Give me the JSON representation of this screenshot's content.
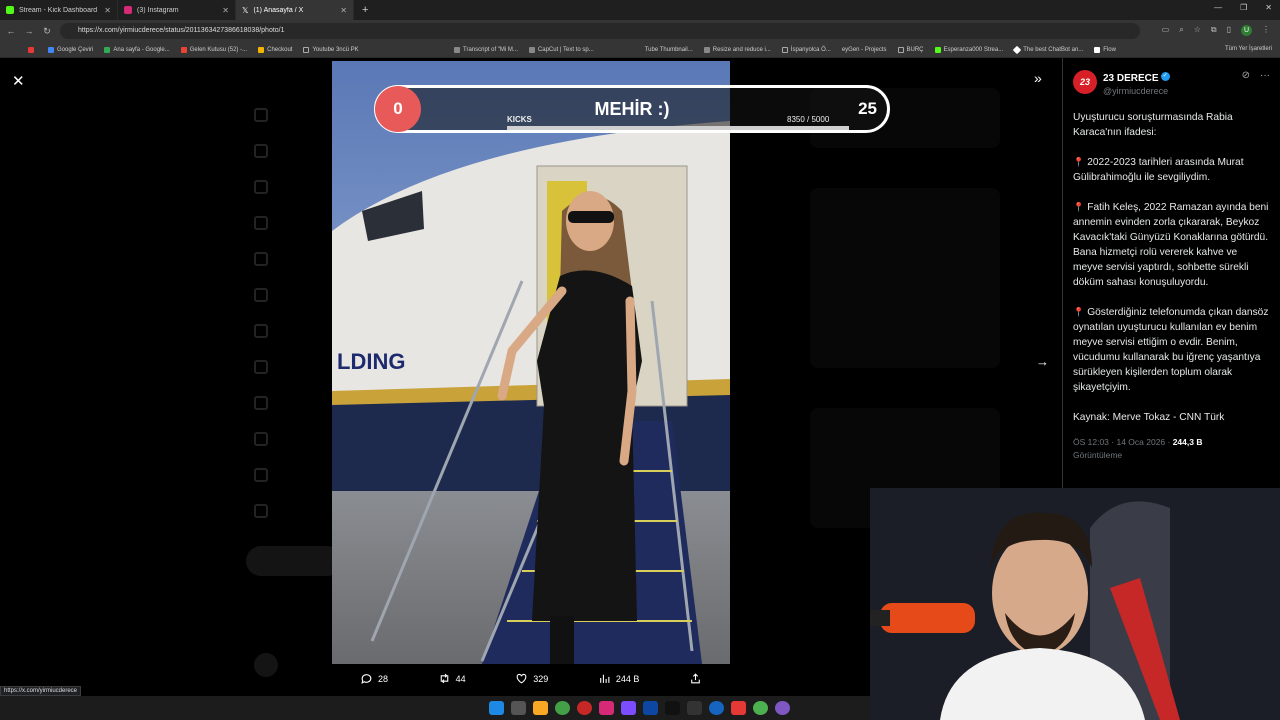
{
  "browser": {
    "tabs": [
      {
        "label": "Stream - Kick Dashboard",
        "color": "#53fc18"
      },
      {
        "label": "(3) Instagram",
        "color": "#d62976"
      },
      {
        "label": "(1) Anasayfa / X",
        "color": "#ffffff"
      }
    ],
    "url": "https://x.com/yirmiucderece/status/2011363427386618038/photo/1",
    "profile_initial": "U",
    "bookmarks": [
      "Google Çeviri",
      "Ana sayfa - Google...",
      "Gelen Kutusu (52) -...",
      "Checkout",
      "Youtube 3ncü PK",
      "Transcript of \"Mi M...",
      "CapCut | Text to sp...",
      "Tube Thumbnail...",
      "Resize and reduce i...",
      "İspanyolca Ö...",
      "eyGen - Projects",
      "BURÇ",
      "Esperanza000 Strea...",
      "The best ChatBot an...",
      "Flow"
    ],
    "bookmarks_right": "Tüm Yer İşaretleri"
  },
  "overlay": {
    "left_count": "0",
    "name": "MEHİR :)",
    "right_count": "25",
    "label": "KICKS",
    "progress_text": "8350  / 5000",
    "progress_fraction": 1.0
  },
  "photo": {
    "plane_text": "LDING"
  },
  "actions": {
    "replies": "28",
    "reposts": "44",
    "likes": "329",
    "views": "244 B"
  },
  "tweet": {
    "name": "23 DERECE",
    "handle": "@yirmiucderece",
    "avatar_text": "23",
    "intro": "Uyuşturucu soruşturmasında Rabia Karaca'nın ifadesi:",
    "p1": "2022-2023 tarihleri arasında Murat Gülibrahimoğlu ile sevgiliydim.",
    "p2": "Fatih Keleş,  2022 Ramazan ayında beni annemin evinden zorla çıkararak, Beykoz Kavacık'taki Günyüzü Konaklarına götürdü. Bana hizmetçi rolü vererek kahve ve meyve servisi yaptırdı, sohbette sürekli döküm sahası konuşuluyordu.",
    "p3": "Gösterdiğiniz telefonumda çıkan dansöz oynatılan uyuşturucu kullanılan ev benim meyve servisi ettiğim o evdir. Benim, vücudumu kullanarak bu iğrenç yaşantıya sürükleyen kişilerden toplum olarak şikayetçiyim.",
    "source": "Kaynak: Merve Tokaz - CNN Türk",
    "time": "ÖS 12:03 · 14 Oca 2026 · ",
    "views_count": "244,3 B",
    "views_label": "Görüntüleme"
  },
  "status_link": "https://x.com/yirmiucderece"
}
